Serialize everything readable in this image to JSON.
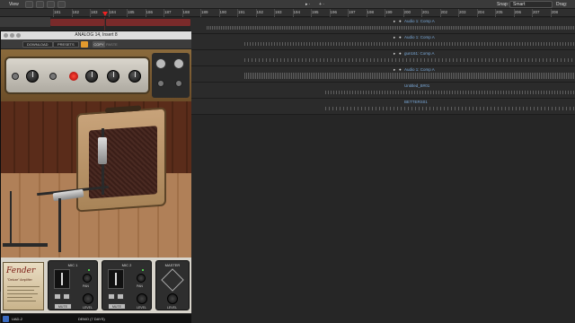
{
  "topbar": {
    "view_label": "View",
    "snap_label": "Snap:",
    "snap_value": "Smart",
    "drag_label": "Drag:"
  },
  "ruler": {
    "numbers": [
      "181",
      "182",
      "183",
      "184",
      "185",
      "186",
      "187",
      "188",
      "189",
      "190",
      "191",
      "192",
      "193",
      "194",
      "195",
      "196",
      "197",
      "198",
      "199",
      "200",
      "201",
      "202",
      "203",
      "204",
      "205",
      "206",
      "207",
      "208"
    ]
  },
  "tracks": [
    {
      "name": "Audio 1: Comp A",
      "has_controls": true
    },
    {
      "name": "Audio 1: Comp A",
      "has_controls": true
    },
    {
      "name": "gun161: Comp A",
      "has_controls": true
    },
    {
      "name": "Audio 1: Comp A",
      "has_controls": true
    },
    {
      "name": "Untitled_B#01",
      "has_controls": false
    },
    {
      "name": "BETTERS01",
      "has_controls": false
    }
  ],
  "plugin": {
    "title": "ANALOG 14, Insert 8",
    "toolbar": {
      "load_label": "DOWNLOAD",
      "presets_label": "PRESETS",
      "copy_label": "COPY",
      "paste_label": "PASTE"
    },
    "mic1_label": "MIC 1",
    "mic2_label": "MIC 2",
    "master_label": "MASTER",
    "mute_label": "MUTE",
    "level_label": "LEVEL",
    "pan_label": "PAN",
    "badge_brand": "Fender",
    "badge_model": "\"Deluxe\" Amplifier",
    "status_left": "UAD-2",
    "status_center": "DEMO (7 DAYS)"
  },
  "colors": {
    "accent": "#e39a2d",
    "region_name": "#7aa9d9",
    "playhead": "#e22222"
  }
}
